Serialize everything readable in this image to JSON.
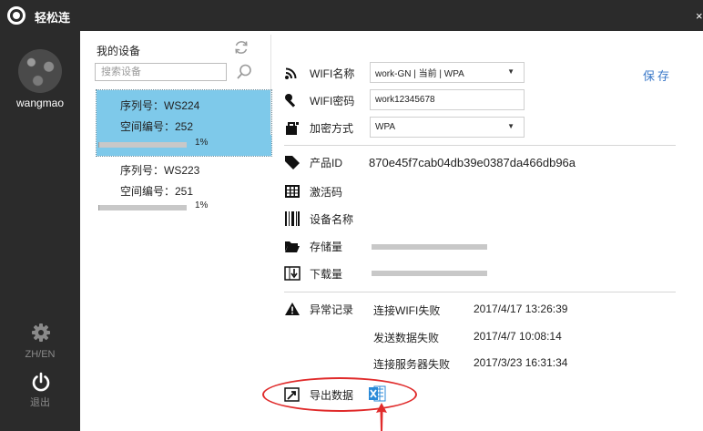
{
  "titlebar": {
    "app_name": "轻松连",
    "close": "×"
  },
  "nav": {
    "username": "wangmao",
    "lang": "ZH/EN",
    "exit": "退出"
  },
  "devices": {
    "title": "我的设备",
    "search_placeholder": "搜索设备",
    "items": [
      {
        "serial": "序列号：WS224",
        "room": "空间编号：252",
        "progress_label": "1%",
        "progress": 0.01,
        "selected": true
      },
      {
        "serial": "序列号：WS223",
        "room": "空间编号：251",
        "progress_label": "1%",
        "progress": 0.01,
        "selected": false
      }
    ]
  },
  "wifi": {
    "name_label": "WIFI名称",
    "name_value": "work-GN | 当前 | WPA",
    "password_label": "WIFI密码",
    "password_value": "work12345678",
    "encryption_label": "加密方式",
    "encryption_value": "WPA",
    "save_label": "保存"
  },
  "product": {
    "id_label": "产品ID",
    "id_value": "870e45f7cab04db39e0387da466db96a",
    "activation_label": "激活码",
    "device_name_label": "设备名称",
    "storage_label": "存储量",
    "download_label": "下载量"
  },
  "errors": {
    "label": "异常记录",
    "records": [
      {
        "event": "连接WIFI失败",
        "time": "2017/4/17 13:26:39"
      },
      {
        "event": "发送数据失败",
        "time": "2017/4/7 10:08:14"
      },
      {
        "event": "连接服务器失败",
        "time": "2017/3/23 16:31:34"
      }
    ]
  },
  "export": {
    "label": "导出数据"
  },
  "colors": {
    "accent": "#3a78c8",
    "selected": "#7ec9ea",
    "annotation": "#e02b2b",
    "sidebar": "#2b2b2b"
  }
}
